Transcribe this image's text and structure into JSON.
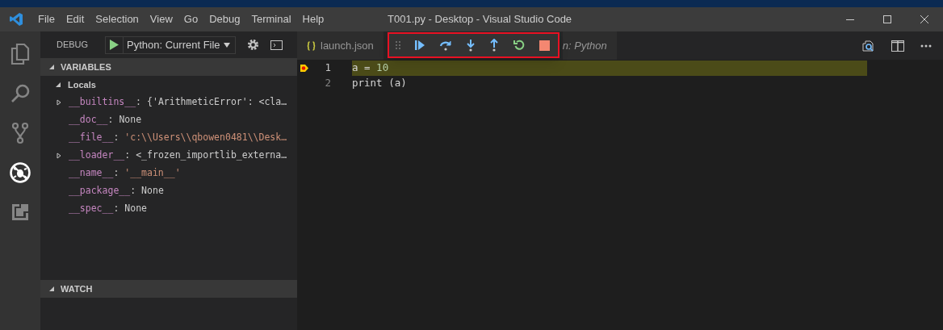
{
  "menu": [
    "File",
    "Edit",
    "Selection",
    "View",
    "Go",
    "Debug",
    "Terminal",
    "Help"
  ],
  "window": {
    "title": "T001.py - Desktop - Visual Studio Code"
  },
  "activity_bar": [
    {
      "kind": "files",
      "selected": false
    },
    {
      "kind": "search",
      "selected": false
    },
    {
      "kind": "scm",
      "selected": false
    },
    {
      "kind": "debug",
      "selected": true
    },
    {
      "kind": "extensions",
      "selected": false
    }
  ],
  "debug_header": {
    "label": "DEBUG",
    "configuration": "Python: Current File"
  },
  "variables": {
    "title": "VARIABLES",
    "expanded": true,
    "scope": {
      "label": "Locals",
      "expanded": true
    },
    "items": [
      {
        "name": "__builtins__",
        "separator": ":",
        "value": "{'ArithmeticError': <cla…",
        "kind": "plain",
        "expandable": true
      },
      {
        "name": "__doc__",
        "separator": ":",
        "value": "None",
        "kind": "plain",
        "expandable": false
      },
      {
        "name": "__file__",
        "separator": ":",
        "value": "'c:\\\\Users\\\\qbowen0481\\\\Desk…",
        "kind": "string",
        "expandable": false
      },
      {
        "name": "__loader__",
        "separator": ":",
        "value": "<_frozen_importlib_externa…",
        "kind": "plain",
        "expandable": true
      },
      {
        "name": "__name__",
        "separator": ":",
        "value": "'__main__'",
        "kind": "string",
        "expandable": false
      },
      {
        "name": "__package__",
        "separator": ":",
        "value": "None",
        "kind": "plain",
        "expandable": false
      },
      {
        "name": "__spec__",
        "separator": ":",
        "value": "None",
        "kind": "plain",
        "expandable": false
      }
    ]
  },
  "watch": {
    "title": "WATCH",
    "expanded": true
  },
  "tabs": [
    {
      "label": "launch.json",
      "kind": "json",
      "selected": false
    },
    {
      "label": "n: Python",
      "kind": "italic",
      "selected": false
    }
  ],
  "debug_toolbar": [
    {
      "kind": "continue"
    },
    {
      "kind": "step-over"
    },
    {
      "kind": "step-into"
    },
    {
      "kind": "step-out"
    },
    {
      "kind": "restart"
    },
    {
      "kind": "stop"
    }
  ],
  "editor": {
    "lines": [
      {
        "number": "1",
        "current": true,
        "tokens": [
          {
            "text": "a = ",
            "kind": "plain"
          },
          {
            "text": "10",
            "kind": "number"
          }
        ]
      },
      {
        "number": "2",
        "current": false,
        "tokens": [
          {
            "text": "print (a)",
            "kind": "plain"
          }
        ]
      }
    ]
  }
}
